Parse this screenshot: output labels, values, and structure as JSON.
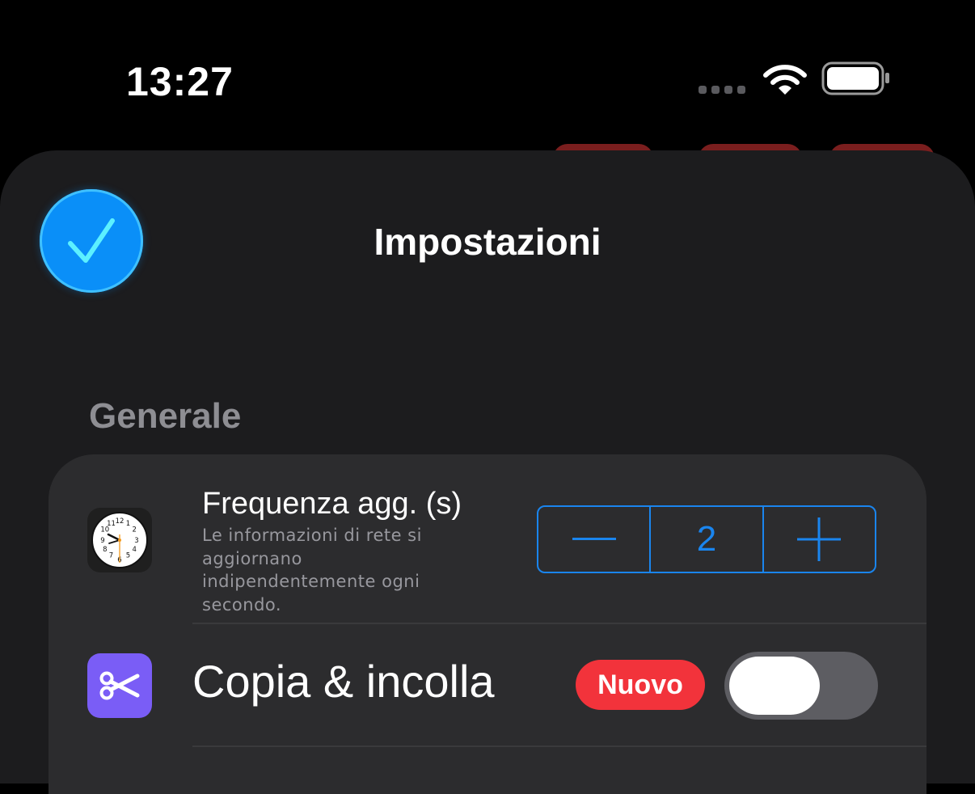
{
  "status_bar": {
    "time": "13:27",
    "icons": [
      "signal-dots-icon",
      "wifi-icon",
      "battery-icon"
    ]
  },
  "sheet": {
    "title": "Impostazioni",
    "done_icon": "checkmark-icon",
    "accent_color": "#0a8ff8"
  },
  "sections": [
    {
      "header": "Generale",
      "rows": [
        {
          "icon": "clock-icon",
          "title": "Frequenza agg. (s)",
          "subtitle": "Le informazioni di rete si aggiornano indipendentemente ogni secondo.",
          "stepper": {
            "minus_label": "—",
            "value": "2",
            "plus_label": "+"
          }
        },
        {
          "icon": "scissors-icon",
          "title": "Copia & incolla",
          "badge": "Nuovo",
          "badge_color": "#f2333b",
          "toggle_on": false
        }
      ]
    }
  ]
}
